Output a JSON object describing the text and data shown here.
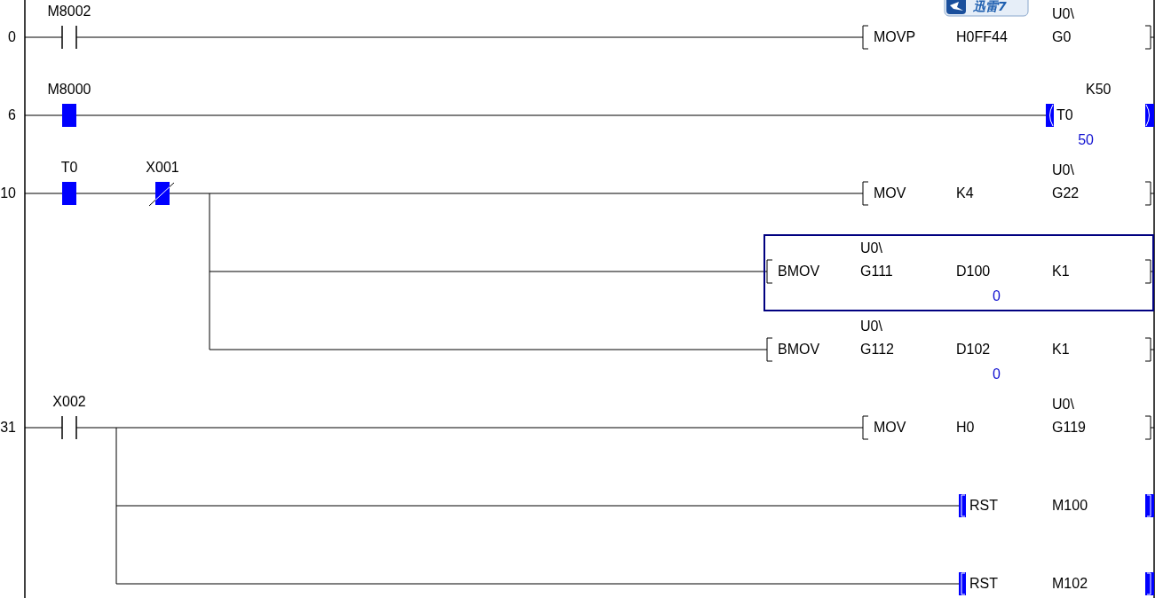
{
  "overlay_badge": {
    "text": "迅雷7"
  },
  "rungs": [
    {
      "step": "0",
      "contacts": [
        {
          "device": "M8002",
          "kind": "no",
          "on": false
        }
      ],
      "outputs": [
        {
          "kind": "instruction",
          "selected": false,
          "mnemonic": "MOVP",
          "operands": [
            {
              "text": "H0FF44"
            },
            {
              "prefix": "U0\\",
              "text": "G0"
            }
          ]
        }
      ]
    },
    {
      "step": "6",
      "contacts": [
        {
          "device": "M8000",
          "kind": "no",
          "on": true
        }
      ],
      "outputs": [
        {
          "kind": "coil",
          "on": true,
          "device": "T0",
          "setting": "K50",
          "value": "50"
        }
      ]
    },
    {
      "step": "10",
      "contacts": [
        {
          "device": "T0",
          "kind": "no",
          "on": true
        },
        {
          "device": "X001",
          "kind": "nc",
          "on": true
        }
      ],
      "outputs": [
        {
          "kind": "instruction",
          "selected": false,
          "mnemonic": "MOV",
          "operands": [
            {
              "text": "K4"
            },
            {
              "prefix": "U0\\",
              "text": "G22"
            }
          ]
        },
        {
          "kind": "instruction",
          "selected": true,
          "mnemonic": "BMOV",
          "operands": [
            {
              "prefix": "U0\\",
              "text": "G111"
            },
            {
              "text": "D100",
              "value": "0"
            },
            {
              "text": "K1"
            }
          ]
        },
        {
          "kind": "instruction",
          "selected": false,
          "mnemonic": "BMOV",
          "operands": [
            {
              "prefix": "U0\\",
              "text": "G112"
            },
            {
              "text": "D102",
              "value": "0"
            },
            {
              "text": "K1"
            }
          ]
        }
      ]
    },
    {
      "step": "31",
      "contacts": [
        {
          "device": "X002",
          "kind": "no",
          "on": false
        }
      ],
      "outputs": [
        {
          "kind": "instruction",
          "selected": false,
          "mnemonic": "MOV",
          "operands": [
            {
              "text": "H0"
            },
            {
              "prefix": "U0\\",
              "text": "G119"
            }
          ]
        },
        {
          "kind": "rst",
          "on": true,
          "mnemonic": "RST",
          "operands": [
            {
              "text": "M100"
            }
          ]
        },
        {
          "kind": "rst",
          "on": true,
          "mnemonic": "RST",
          "operands": [
            {
              "text": "M102"
            }
          ]
        }
      ]
    }
  ]
}
